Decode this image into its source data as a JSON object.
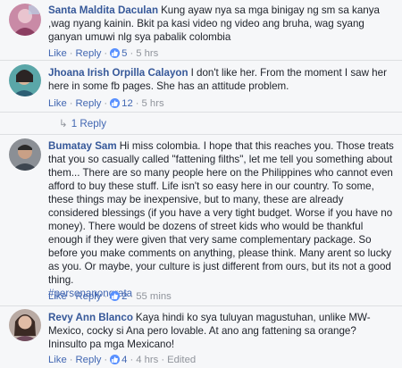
{
  "ui": {
    "like": "Like",
    "reply": "Reply",
    "sep": "·",
    "like_color": "#5890ff",
    "link_color": "#4267b2",
    "author_color": "#365899"
  },
  "comments": [
    {
      "author": "Santa Maldita Daculan",
      "text": "Kung ayaw nya sa mga binigay ng sm sa kanya ,wag nyang kainin. Bkit pa kasi video ng video ang bruha, wag syang ganyan umuwi nlg sya pabalik colombia",
      "likes": "5",
      "time": "5 hrs",
      "avatar_icon": "avatar-pink-photo"
    },
    {
      "author": "Jhoana Irish Orpilla Calayon",
      "text": "I don't like her. From the moment I saw her here in some fb pages. She has an attitude problem.",
      "likes": "12",
      "time": "5 hrs",
      "avatar_icon": "avatar-teal-photo",
      "replies_label": "1 Reply"
    },
    {
      "author": "Bumatay Sam",
      "text": "Hi miss colombia. I hope that this reaches you. Those treats that you so casually called \"fattening filths\", let me tell you something about them... There are so many people here on the Philippines who cannot even afford to buy these stuff. Life isn't so easy here in our country. To some, these things may be inexpensive, but to many, these are already considered blessings (if you have a very tight budget. Worse if you have no money). There would be dozens of street kids who would be thankful enough if they were given that very same complementary package. So before you make comments on anything, please think. Many arent so lucky as you. Or maybe, your culture is just different from ours, but its not a good thing.",
      "hashtag": "#personanongrata",
      "likes": "2",
      "time": "55 mins",
      "avatar_icon": "avatar-man-photo"
    },
    {
      "author": "Revy Ann Blanco",
      "text": "Kaya hindi ko sya tuluyan magustuhan, unlike MW-Mexico, cocky si Ana pero lovable. At ano ang fattening sa orange? Ininsulto pa mga Mexicano!",
      "likes": "4",
      "time": "4 hrs",
      "edited": "Edited",
      "avatar_icon": "avatar-woman-photo"
    }
  ]
}
